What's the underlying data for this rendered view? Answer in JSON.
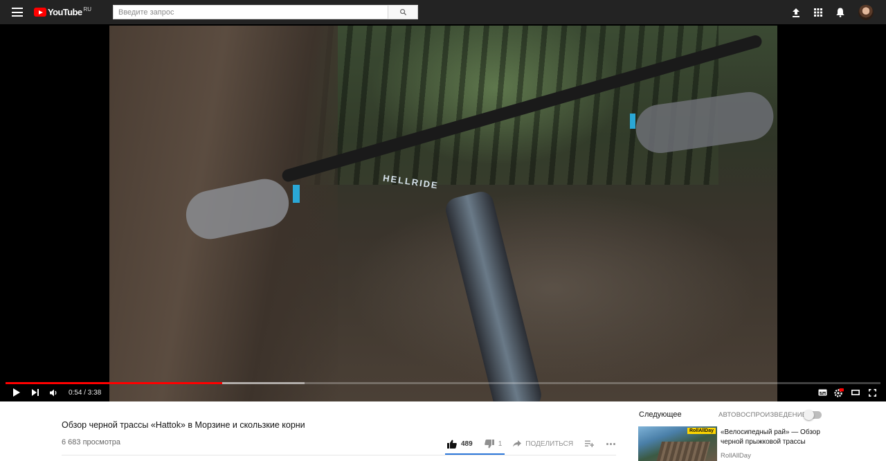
{
  "masthead": {
    "logo_text": "YouTube",
    "region": "RU",
    "search": {
      "placeholder": "Введите запрос",
      "value": ""
    },
    "icons": [
      "menu-icon",
      "search-icon",
      "upload-icon",
      "apps-icon",
      "notifications-icon",
      "avatar"
    ]
  },
  "player": {
    "time_display": "0:54 / 3:38",
    "progress": {
      "played_fraction": 0.2477,
      "loaded_fraction": 0.342
    },
    "video_overlay_text": "HELLRIDE",
    "colors": {
      "progress_played": "#ff0000",
      "background": "#000000"
    }
  },
  "video": {
    "title": "Обзор черной трассы «Hattok» в Морзине и скользкие корни",
    "views": "6 683 просмотра",
    "likes": "489",
    "dislikes": "1",
    "share_label": "ПОДЕЛИТЬСЯ"
  },
  "sidebar": {
    "next_label": "Следующее",
    "autoplay_label": "АВТОВОСПРОИЗВЕДЕНИЕ",
    "autoplay_on": false,
    "next_item": {
      "title": "«Велосипедный рай» — Обзор черной прыжковой трассы",
      "channel": "RollAllDay",
      "badge": "RollAllDay"
    }
  }
}
